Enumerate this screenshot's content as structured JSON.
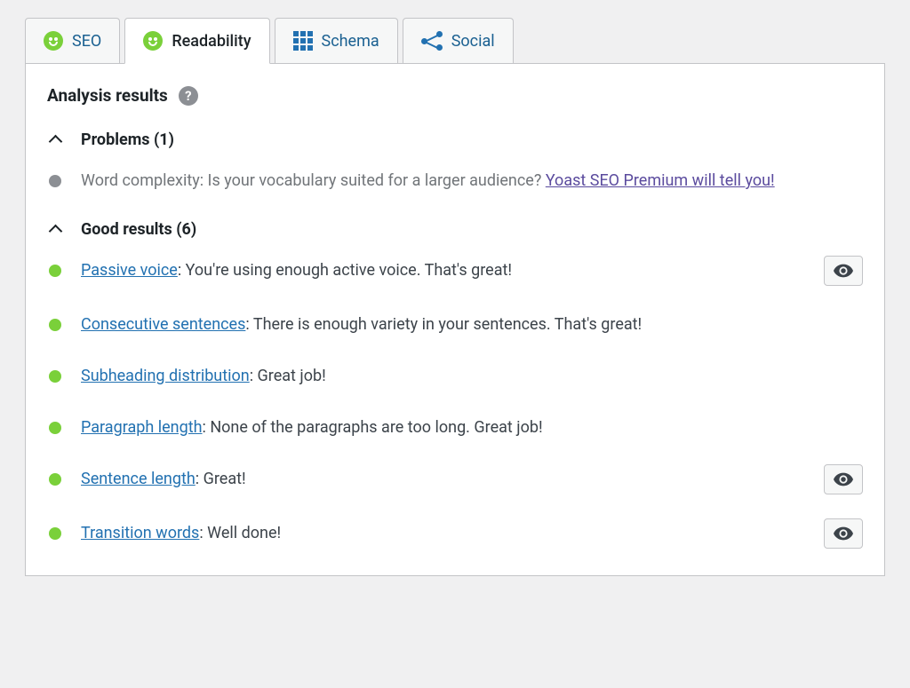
{
  "tabs": {
    "seo": "SEO",
    "readability": "Readability",
    "schema": "Schema",
    "social": "Social"
  },
  "panel": {
    "title": "Analysis results"
  },
  "problems": {
    "header": "Problems (1)",
    "items": [
      {
        "prefix": "Word complexity: Is your vocabulary suited for a larger audience? ",
        "link": "Yoast SEO Premium will tell you!"
      }
    ]
  },
  "good": {
    "header": "Good results (6)",
    "items": [
      {
        "link": "Passive voice",
        "text": ": You're using enough active voice. That's great!",
        "eye": true
      },
      {
        "link": "Consecutive sentences",
        "text": ": There is enough variety in your sentences. That's great!",
        "eye": false
      },
      {
        "link": "Subheading distribution",
        "text": ": Great job!",
        "eye": false
      },
      {
        "link": "Paragraph length",
        "text": ": None of the paragraphs are too long. Great job!",
        "eye": false
      },
      {
        "link": "Sentence length",
        "text": ": Great!",
        "eye": true
      },
      {
        "link": "Transition words",
        "text": ": Well done!",
        "eye": true
      }
    ]
  }
}
